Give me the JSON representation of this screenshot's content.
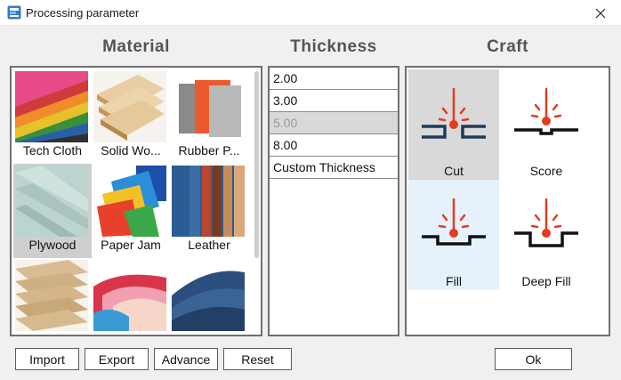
{
  "window": {
    "title": "Processing parameter",
    "icon": "app-logo-icon"
  },
  "sections": {
    "material": "Material",
    "thickness": "Thickness",
    "craft": "Craft"
  },
  "materials": [
    {
      "label": "Tech Cloth",
      "icon": "tech-cloth-icon"
    },
    {
      "label": "Solid Wo...",
      "icon": "solid-wood-icon"
    },
    {
      "label": "Rubber P...",
      "icon": "rubber-plate-icon"
    },
    {
      "label": "Plywood",
      "icon": "plywood-icon"
    },
    {
      "label": "Paper Jam",
      "icon": "paper-jam-icon"
    },
    {
      "label": "Leather",
      "icon": "leather-icon"
    },
    {
      "label": "",
      "icon": "cardboard-icon"
    },
    {
      "label": "",
      "icon": "paper-icon"
    },
    {
      "label": "",
      "icon": "denim-icon"
    }
  ],
  "thickness": {
    "items": [
      "2.00",
      "3.00",
      "5.00",
      "8.00",
      "Custom Thickness"
    ],
    "selected": "5.00"
  },
  "crafts": [
    {
      "label": "Cut",
      "icon": "cut-icon",
      "state": "selected"
    },
    {
      "label": "Score",
      "icon": "score-icon",
      "state": "normal"
    },
    {
      "label": "Fill",
      "icon": "fill-icon",
      "state": "hover"
    },
    {
      "label": "Deep Fill",
      "icon": "deep-fill-icon",
      "state": "normal"
    }
  ],
  "buttons": {
    "import": "Import",
    "export": "Export",
    "advance": "Advance",
    "reset": "Reset",
    "ok": "Ok"
  },
  "colors": {
    "laser_red": "#e53b1f",
    "line_dark": "#111111",
    "cut_blue": "#1f3a5a",
    "selected_bg": "#d9d9d9",
    "hover_bg": "#e5f1fb"
  }
}
